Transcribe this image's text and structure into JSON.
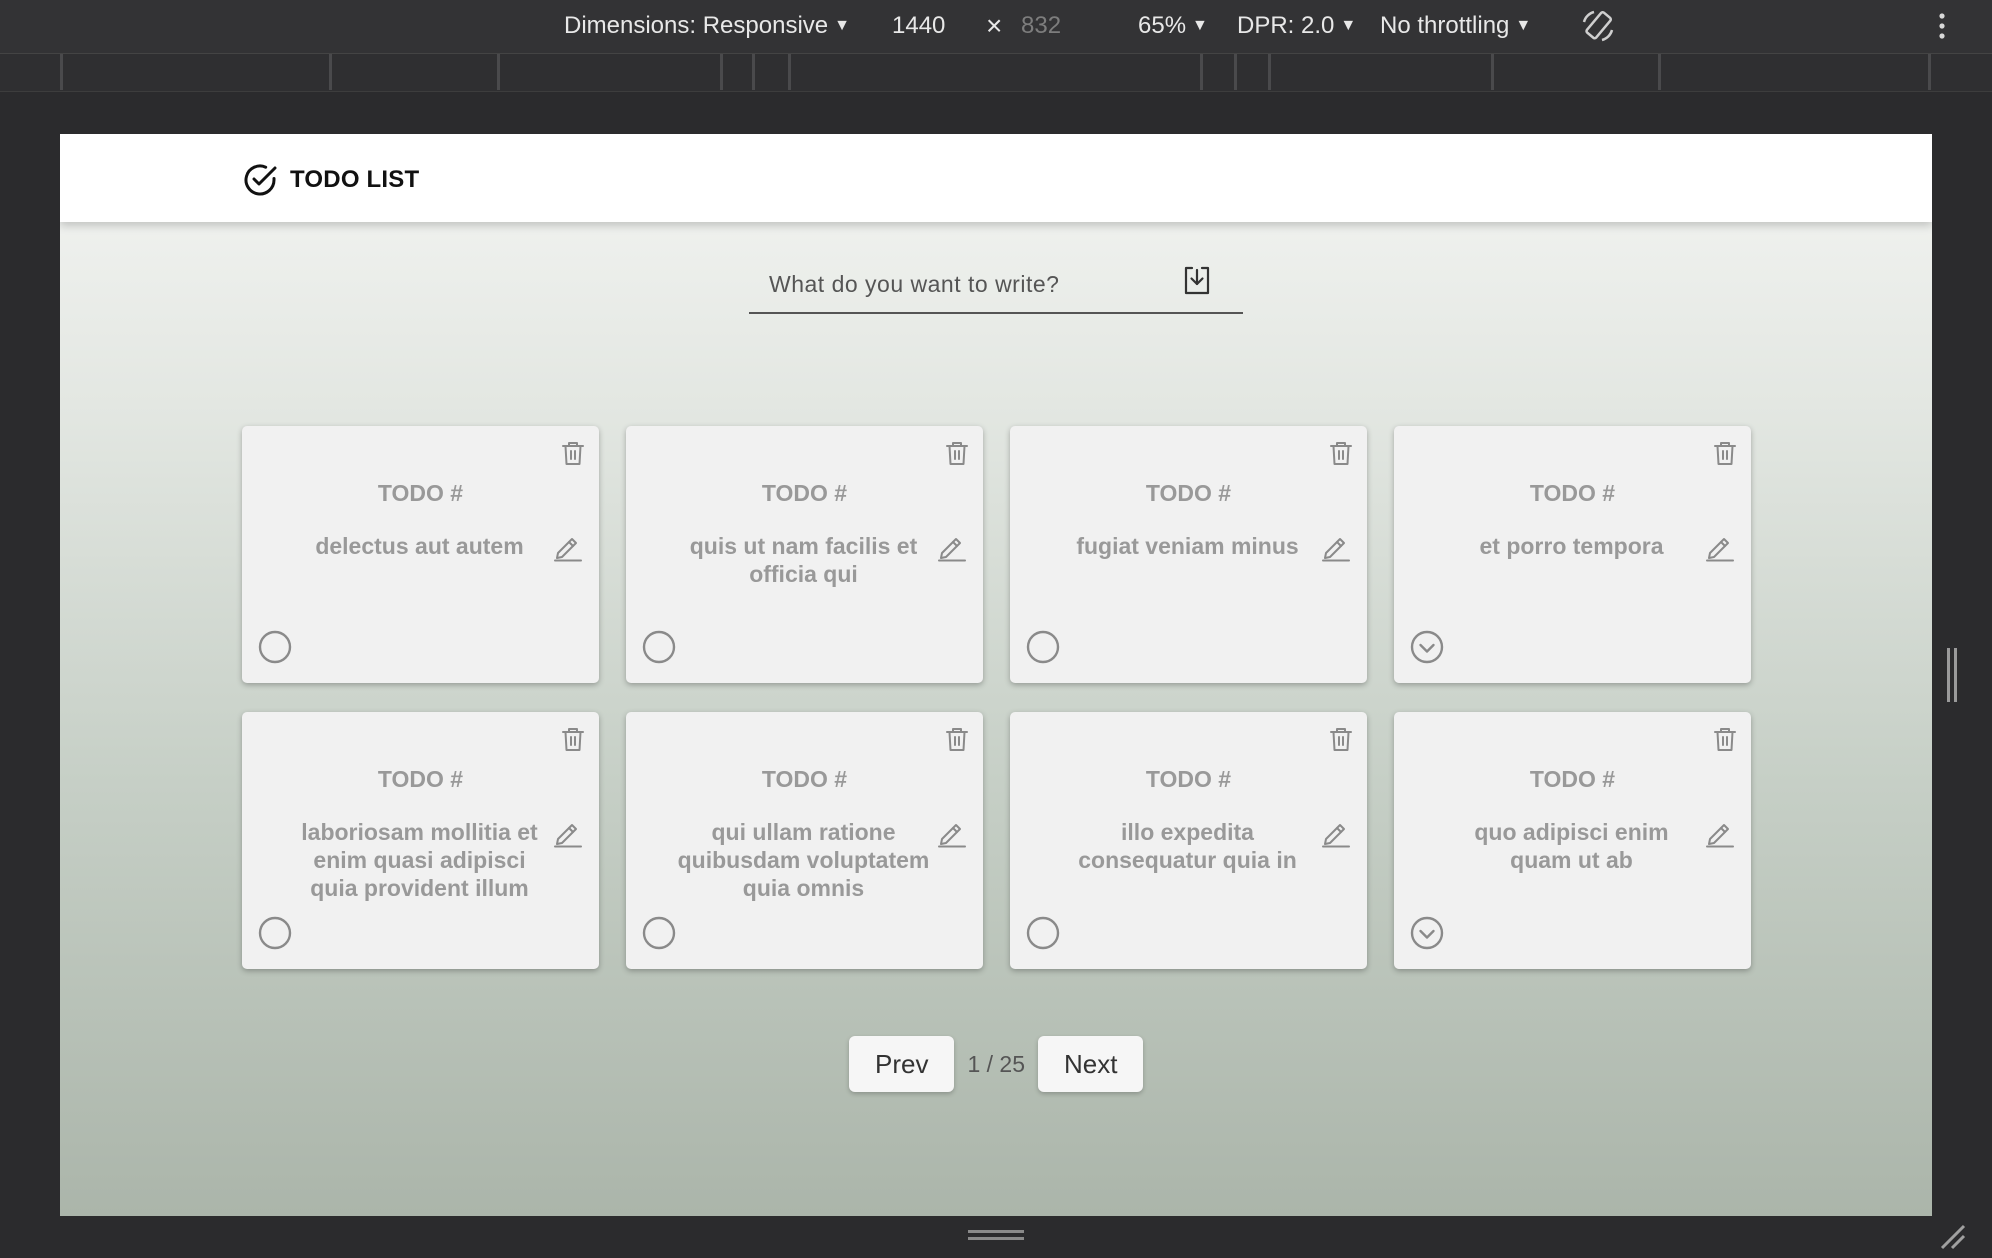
{
  "devtools": {
    "dimensions_label": "Dimensions: Responsive",
    "width": "1440",
    "times": "×",
    "height": "832",
    "zoom": "65%",
    "dpr": "DPR: 2.0",
    "throttle": "No throttling"
  },
  "app": {
    "title": "TODO LIST"
  },
  "new_todo": {
    "placeholder": "What do you want to write?"
  },
  "todos": [
    {
      "title": "TODO #",
      "text": "delectus aut autem",
      "completed": false
    },
    {
      "title": "TODO #",
      "text": "quis ut nam facilis et officia qui",
      "completed": false
    },
    {
      "title": "TODO #",
      "text": "fugiat veniam minus",
      "completed": false
    },
    {
      "title": "TODO #",
      "text": "et porro tempora",
      "completed": true
    },
    {
      "title": "TODO #",
      "text": "laboriosam mollitia et enim quasi adipisci quia provident illum",
      "completed": false
    },
    {
      "title": "TODO #",
      "text": "qui ullam ratione quibusdam voluptatem quia omnis",
      "completed": false
    },
    {
      "title": "TODO #",
      "text": "illo expedita consequatur quia in",
      "completed": false
    },
    {
      "title": "TODO #",
      "text": "quo adipisci enim quam ut ab",
      "completed": true
    }
  ],
  "pagination": {
    "prev_label": "Prev",
    "page_info": "1 / 25",
    "next_label": "Next"
  },
  "colors": {
    "card_text": "#999999",
    "icon": "#8a8a8a"
  }
}
